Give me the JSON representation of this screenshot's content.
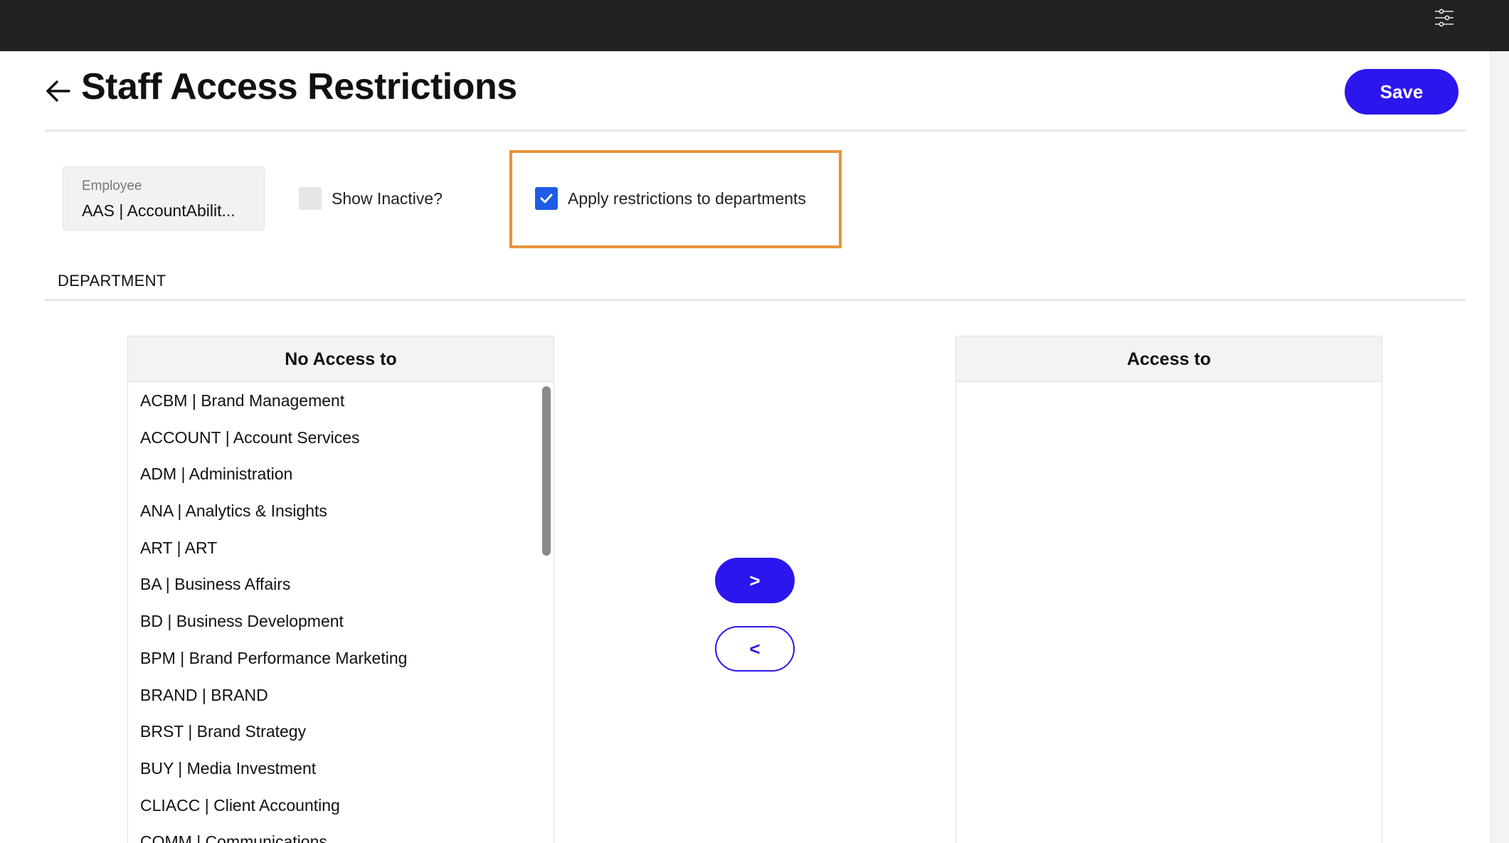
{
  "header": {
    "title": "Staff Access Restrictions",
    "save_label": "Save"
  },
  "filters": {
    "employee_label": "Employee",
    "employee_value": "AAS | AccountAbilit...",
    "show_inactive_label": "Show Inactive?",
    "show_inactive_checked": false,
    "apply_restrictions_label": "Apply restrictions to departments",
    "apply_restrictions_checked": true
  },
  "section": {
    "label": "DEPARTMENT"
  },
  "no_access": {
    "title": "No Access to",
    "items": [
      "ACBM | Brand Management",
      "ACCOUNT | Account Services",
      "ADM | Administration",
      "ANA | Analytics & Insights",
      "ART | ART",
      "BA | Business Affairs",
      "BD | Business Development",
      "BPM | Brand Performance Marketing",
      "BRAND | BRAND",
      "BRST | Brand Strategy",
      "BUY | Media Investment",
      "CLIACC | Client Accounting",
      "COMM | Communications"
    ]
  },
  "access": {
    "title": "Access to",
    "items": []
  },
  "transfer": {
    "move_right_label": ">",
    "move_left_label": "<"
  },
  "icons": {
    "back": "arrow-left-icon",
    "filter": "sliders-icon",
    "check": "checkmark-icon"
  },
  "colors": {
    "primary": "#2b16ee",
    "topbar": "#222222",
    "highlight": "#e8933a",
    "checkbox_checked": "#1e5be6"
  }
}
